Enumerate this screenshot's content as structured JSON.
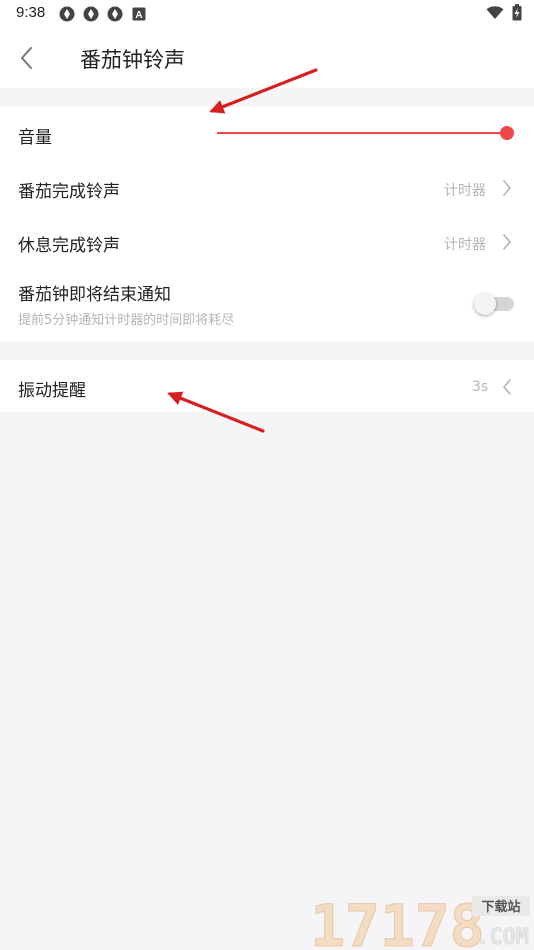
{
  "status_bar": {
    "time": "9:38",
    "left_icons": [
      "app-notification-icon",
      "app-notification-icon",
      "app-notification-icon",
      "a-badge-icon"
    ],
    "a_badge": "A",
    "right_icons": [
      "wifi-icon",
      "battery-charging-icon"
    ]
  },
  "header": {
    "back_icon": "chevron-left-icon",
    "title": "番茄钟铃声"
  },
  "settings": {
    "volume": {
      "label": "音量",
      "level": 1.0
    },
    "pomodoro_done_sound": {
      "label": "番茄完成铃声",
      "value": "计时器"
    },
    "rest_done_sound": {
      "label": "休息完成铃声",
      "value": "计时器"
    },
    "ending_notice": {
      "label": "番茄钟即将结束通知",
      "sublabel": "提前5分钟通知计时器的时间即将耗尽",
      "enabled": false
    },
    "vibration": {
      "label": "振动提醒",
      "value": "3s"
    }
  },
  "colors": {
    "accent": "#f0484a",
    "annotation_arrow": "#d81f1f",
    "background": "#f5f5f7",
    "card": "#ffffff",
    "secondary_text": "#b5b5b5"
  },
  "watermark": {
    "text": "17178",
    "badge": "下载站",
    "suffix": ".COM"
  }
}
